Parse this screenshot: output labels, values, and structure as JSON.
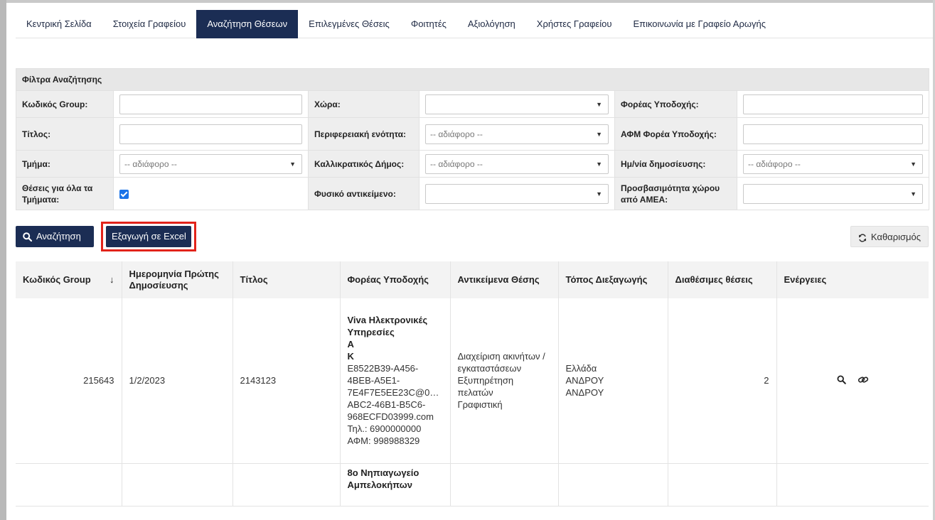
{
  "nav": {
    "items": [
      {
        "label": "Κεντρική Σελίδα",
        "active": false
      },
      {
        "label": "Στοιχεία Γραφείου",
        "active": false
      },
      {
        "label": "Αναζήτηση Θέσεων",
        "active": true
      },
      {
        "label": "Επιλεγμένες Θέσεις",
        "active": false
      },
      {
        "label": "Φοιτητές",
        "active": false
      },
      {
        "label": "Αξιολόγηση",
        "active": false
      },
      {
        "label": "Χρήστες Γραφείου",
        "active": false
      },
      {
        "label": "Επικοινωνία με Γραφείο Αρωγής",
        "active": false
      }
    ]
  },
  "filters": {
    "title": "Φίλτρα Αναζήτησης",
    "group_code_label": "Κωδικός Group:",
    "group_code_value": "",
    "country_label": "Χώρα:",
    "country_value": "",
    "host_label": "Φορέας Υποδοχής:",
    "host_value": "",
    "title_label": "Τίτλος:",
    "title_value": "",
    "region_label": "Περιφερειακή ενότητα:",
    "region_value": "-- αδιάφορο --",
    "host_vat_label": "ΑΦΜ Φορέα Υποδοχής:",
    "host_vat_value": "",
    "department_label": "Τμήμα:",
    "department_value": "-- αδιάφορο --",
    "municipality_label": "Καλλικρατικός Δήμος:",
    "municipality_value": "-- αδιάφορο --",
    "pub_date_label": "Ημ/νία δημοσίευσης:",
    "pub_date_value": "-- αδιάφορο --",
    "all_departments_label": "Θέσεις για όλα τα Τμήματα:",
    "all_departments_checked": true,
    "physical_object_label": "Φυσικό αντικείμενο:",
    "physical_object_value": "",
    "accessibility_label": "Προσβασιμότητα χώρου από ΑΜΕΑ:",
    "accessibility_value": ""
  },
  "buttons": {
    "search": "Αναζήτηση",
    "export_excel": "Εξαγωγή σε Excel",
    "clear": "Καθαρισμός"
  },
  "results": {
    "headers": {
      "group_code": "Κωδικός Group",
      "first_pub_date": "Ημερομηνία Πρώτης Δημοσίευσης",
      "title": "Τίτλος",
      "host": "Φορέας Υποδοχής",
      "objects": "Αντικείμενα Θέσης",
      "location": "Τόπος Διεξαγωγής",
      "available": "Διαθέσιμες θέσεις",
      "actions": "Ενέργειες"
    },
    "sort_indicator": "↓",
    "rows": [
      {
        "group_code": "215643",
        "first_pub_date": "1/2/2023",
        "title": "2143123",
        "host_name_line1": "Viva Ηλεκτρονικές",
        "host_name_line2": "Υπηρεσίες",
        "host_name_line3": "Α",
        "host_name_line4": "Κ",
        "host_line1": "E8522B39-A456-",
        "host_line2": "4BEB-A5E1-",
        "host_line3": "7E4F7E5EE23C@0…",
        "host_line4": "ABC2-46B1-B5C6-",
        "host_line5": "968ECFD03999.com",
        "host_phone": "Τηλ.: 6900000000",
        "host_vat": "ΑΦΜ: 998988329",
        "objects_line1": "Διαχείριση ακινήτων /",
        "objects_line2": "εγκαταστάσεων",
        "objects_line3": "Εξυπηρέτηση πελατών",
        "objects_line4": "Γραφιστική",
        "location_line1": "Ελλάδα",
        "location_line2": "ΑΝΔΡΟΥ",
        "location_line3": "ΑΝΔΡΟΥ",
        "available": "2"
      },
      {
        "host_name_line1": "8ο Νηπιαγωγείο",
        "host_name_line2": "Αμπελοκήπων"
      }
    ]
  }
}
